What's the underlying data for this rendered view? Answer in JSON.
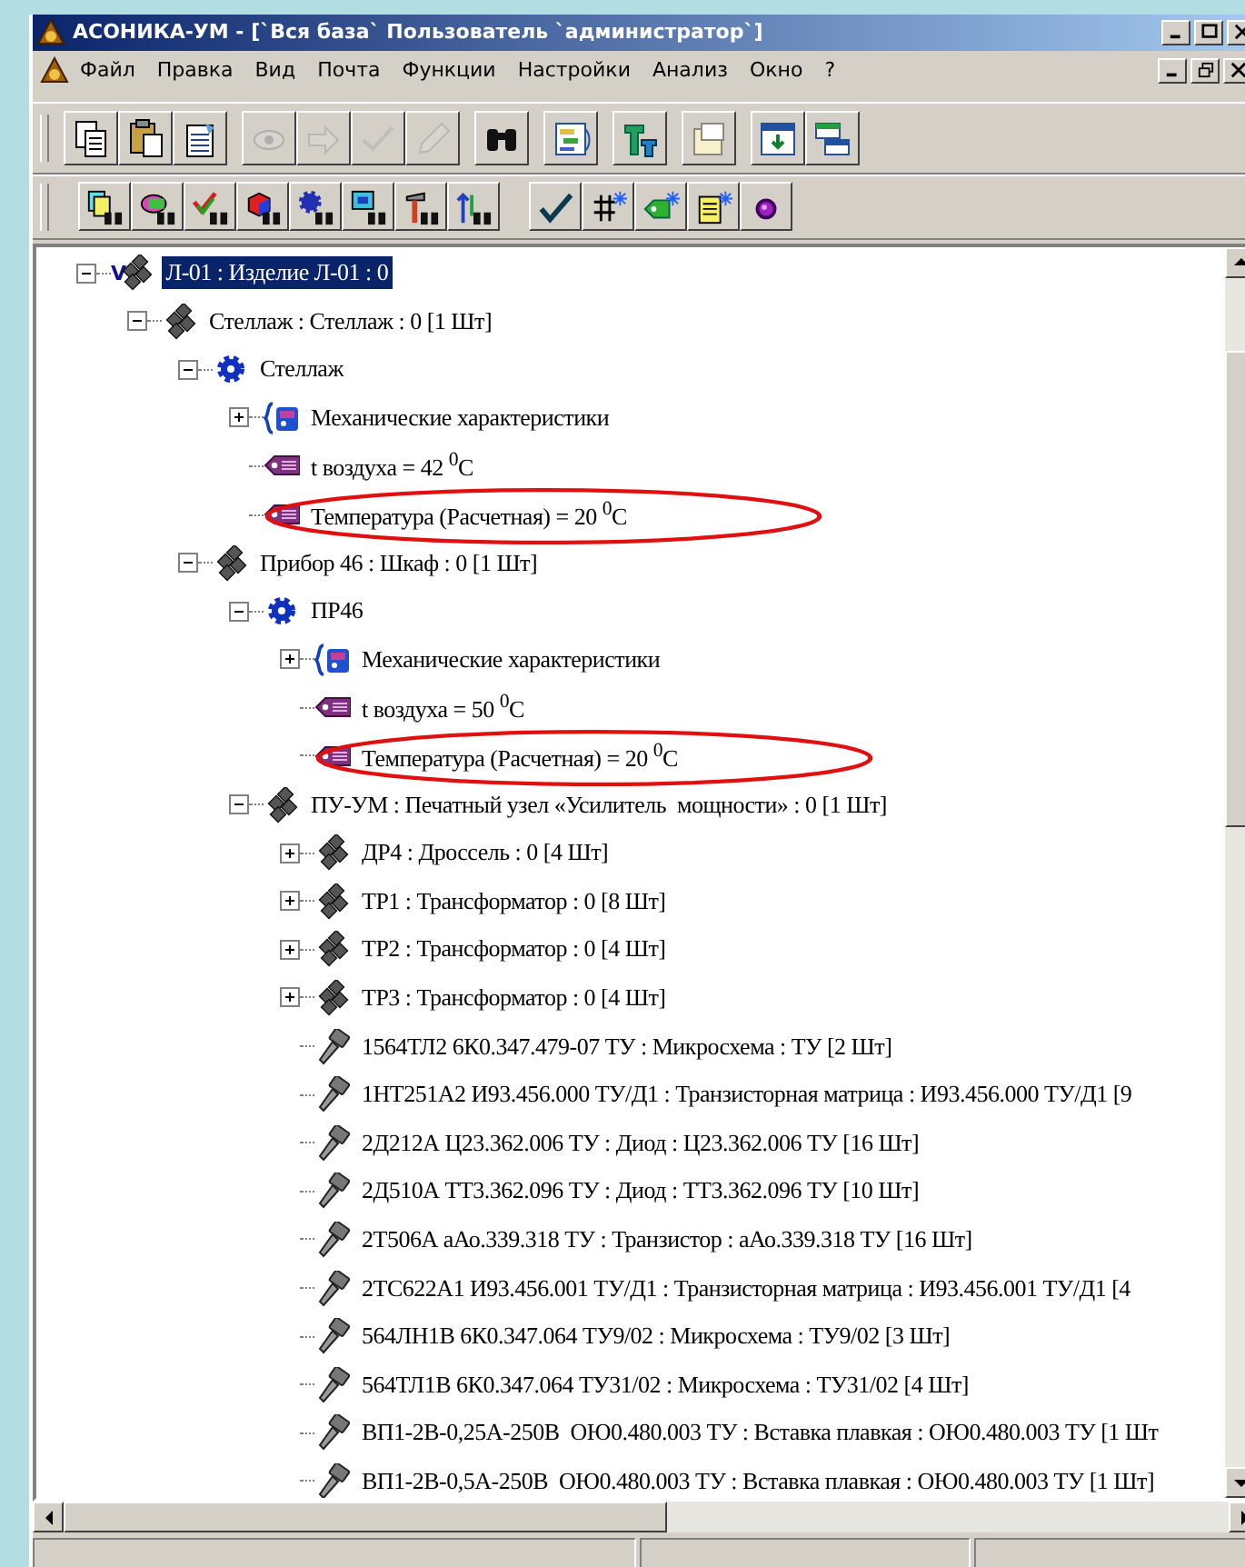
{
  "window": {
    "title": "АСОНИКА-УМ - [`Вся база` Пользователь `администратор`]"
  },
  "menu": [
    "Файл",
    "Правка",
    "Вид",
    "Почта",
    "Функции",
    "Настройки",
    "Анализ",
    "Окно",
    "?"
  ],
  "toolbars": [
    [
      [
        {
          "kind": "copy",
          "disabled": false
        },
        {
          "kind": "paste",
          "disabled": false
        },
        {
          "kind": "properties",
          "disabled": false
        }
      ],
      [
        {
          "kind": "view",
          "disabled": true
        },
        {
          "kind": "forward",
          "disabled": true
        },
        {
          "kind": "approve",
          "disabled": true
        },
        {
          "kind": "edit",
          "disabled": true
        }
      ],
      [
        {
          "kind": "find",
          "disabled": false
        }
      ],
      [
        {
          "kind": "structure",
          "disabled": false
        }
      ],
      [
        {
          "kind": "terminals",
          "disabled": false
        }
      ],
      [
        {
          "kind": "document",
          "disabled": false
        }
      ],
      [
        {
          "kind": "import",
          "disabled": false
        },
        {
          "kind": "windows",
          "disabled": false
        }
      ]
    ],
    [
      [
        {
          "kind": "find-docs",
          "disabled": false
        },
        {
          "kind": "find-tag",
          "disabled": false
        },
        {
          "kind": "find-check",
          "disabled": false
        },
        {
          "kind": "find-cube",
          "disabled": false
        },
        {
          "kind": "find-gear",
          "disabled": false
        },
        {
          "kind": "find-monitor",
          "disabled": false
        },
        {
          "kind": "find-tools",
          "disabled": false
        },
        {
          "kind": "find-arrows",
          "disabled": false
        }
      ],
      [
        {
          "kind": "check",
          "disabled": false
        },
        {
          "kind": "new-grid",
          "disabled": false
        },
        {
          "kind": "new-tag",
          "disabled": false
        },
        {
          "kind": "new-doc",
          "disabled": false
        },
        {
          "kind": "circle",
          "disabled": false
        }
      ]
    ]
  ],
  "tree": [
    {
      "kind": "assembly",
      "prefix": "V",
      "label": "Л-01 : Изделие Л-01 : 0",
      "selected": true,
      "expanded": true,
      "children": [
        {
          "kind": "assembly",
          "label": "Стеллаж : Стеллаж : 0 [1 Шт]",
          "selected": false,
          "expanded": true,
          "children": [
            {
              "kind": "settings",
              "label": "Стеллаж",
              "selected": false,
              "expanded": true,
              "children": [
                {
                  "kind": "group",
                  "label": "Механические характеристики",
                  "selected": false,
                  "expanded": false
                },
                {
                  "kind": "param",
                  "label": "t воздуха = 42 $^{0}$C",
                  "selected": false
                },
                {
                  "kind": "param",
                  "label": "Температура (Расчетная) = 20 $^{0}$C",
                  "selected": false,
                  "circled": true
                }
              ]
            },
            {
              "kind": "assembly",
              "label": "Прибор 46 : Шкаф : 0 [1 Шт]",
              "selected": false,
              "expanded": true,
              "children": [
                {
                  "kind": "settings",
                  "label": "ПР46",
                  "selected": false,
                  "expanded": true,
                  "children": [
                    {
                      "kind": "group",
                      "label": "Механические характеристики",
                      "selected": false,
                      "expanded": false
                    },
                    {
                      "kind": "param",
                      "label": "t воздуха = 50 $^{0}$C",
                      "selected": false
                    },
                    {
                      "kind": "param",
                      "label": "Температура (Расчетная) = 20 $^{0}$C",
                      "selected": false,
                      "circled": true
                    }
                  ]
                },
                {
                  "kind": "assembly",
                  "label": "ПУ-УМ : Печатный узел «Усилитель  мощности» : 0 [1 Шт]",
                  "selected": false,
                  "expanded": true,
                  "children": [
                    {
                      "kind": "assembly",
                      "label": "ДР4 : Дроссель : 0 [4 Шт]",
                      "selected": false,
                      "expanded": false
                    },
                    {
                      "kind": "assembly",
                      "label": "ТР1 : Трансформатор : 0 [8 Шт]",
                      "selected": false,
                      "expanded": false
                    },
                    {
                      "kind": "assembly",
                      "label": "ТР2 : Трансформатор : 0 [4 Шт]",
                      "selected": false,
                      "expanded": false
                    },
                    {
                      "kind": "assembly",
                      "label": "ТР3 : Трансформатор : 0 [4 Шт]",
                      "selected": false,
                      "expanded": false
                    },
                    {
                      "kind": "part",
                      "label": "1564ТЛ2 6К0.347.479-07 ТУ : Микросхема : ТУ [2 Шт]",
                      "selected": false
                    },
                    {
                      "kind": "part",
                      "label": "1НТ251А2 И93.456.000 ТУ/Д1 : Транзисторная матрица : И93.456.000 ТУ/Д1 [9",
                      "selected": false
                    },
                    {
                      "kind": "part",
                      "label": "2Д212А Ц23.362.006 ТУ : Диод : Ц23.362.006 ТУ [16 Шт]",
                      "selected": false
                    },
                    {
                      "kind": "part",
                      "label": "2Д510А ТТ3.362.096 ТУ : Диод : ТТ3.362.096 ТУ [10 Шт]",
                      "selected": false
                    },
                    {
                      "kind": "part",
                      "label": "2Т506А аАо.339.318 ТУ : Транзистор : аАо.339.318 ТУ [16 Шт]",
                      "selected": false
                    },
                    {
                      "kind": "part",
                      "label": "2ТС622А1 И93.456.001 ТУ/Д1 : Транзисторная матрица : И93.456.001 ТУ/Д1 [4",
                      "selected": false
                    },
                    {
                      "kind": "part",
                      "label": "564ЛН1В 6К0.347.064 ТУ9/02 : Микросхема : ТУ9/02 [3 Шт]",
                      "selected": false
                    },
                    {
                      "kind": "part",
                      "label": "564ТЛ1В 6К0.347.064 ТУ31/02 : Микросхема : ТУ31/02 [4 Шт]",
                      "selected": false
                    },
                    {
                      "kind": "part",
                      "label": "ВП1-2В-0,25А-250В  ОЮ0.480.003 ТУ : Вставка плавкая : ОЮ0.480.003 ТУ [1 Шт",
                      "selected": false
                    },
                    {
                      "kind": "part",
                      "label": "ВП1-2В-0,5А-250В  ОЮ0.480.003 ТУ : Вставка плавкая : ОЮ0.480.003 ТУ [1 Шт]",
                      "selected": false
                    }
                  ]
                }
              ]
            }
          ]
        }
      ]
    }
  ]
}
